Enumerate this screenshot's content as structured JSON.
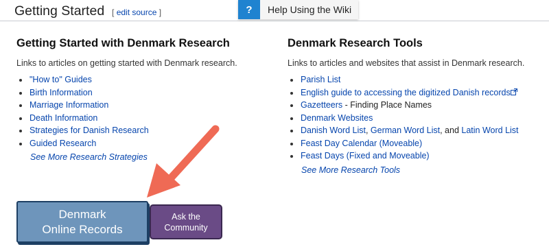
{
  "header": {
    "title": "Getting Started",
    "edit_open": "[",
    "edit_label": "edit source",
    "edit_close": "]",
    "help_icon": "?",
    "help_label": "Help Using the Wiki"
  },
  "left": {
    "heading": "Getting Started with Denmark Research",
    "intro": "Links to articles on getting started with Denmark research.",
    "items": [
      "\"How to\" Guides",
      "Birth Information",
      "Marriage Information",
      "Death Information",
      "Strategies for Danish Research",
      "Guided Research"
    ],
    "more": "See More Research Strategies"
  },
  "right": {
    "heading": "Denmark Research Tools",
    "intro": "Links to articles and websites that assist in Denmark research.",
    "items": {
      "parish_list": "Parish List",
      "english_guide": "English guide to accessing the digitized Danish records",
      "gazetteers": "Gazetteers",
      "gazetteers_suffix": " - Finding Place Names",
      "denmark_websites": "Denmark Websites",
      "danish_word_list": "Danish Word List",
      "comma": ", ",
      "german_word_list": "German Word List",
      "and": ", and ",
      "latin_word_list": "Latin Word List",
      "feast_moveable": "Feast Day Calendar (Moveable)",
      "feast_fixed": "Feast Days (Fixed and Moveable)"
    },
    "more": "See More Research Tools"
  },
  "buttons": {
    "denmark_line1": "Denmark",
    "denmark_line2": "Online Records",
    "community_line1": "Ask the",
    "community_line2": "Community"
  },
  "icons": {
    "external": "external-link-icon",
    "annotation": "arrow-annotation"
  },
  "colors": {
    "link": "#0645ad",
    "help_blue": "#1f83d0",
    "denmark_button": "#6e95bb",
    "community_button": "#6a4b86",
    "arrow": "#ef6a55"
  }
}
